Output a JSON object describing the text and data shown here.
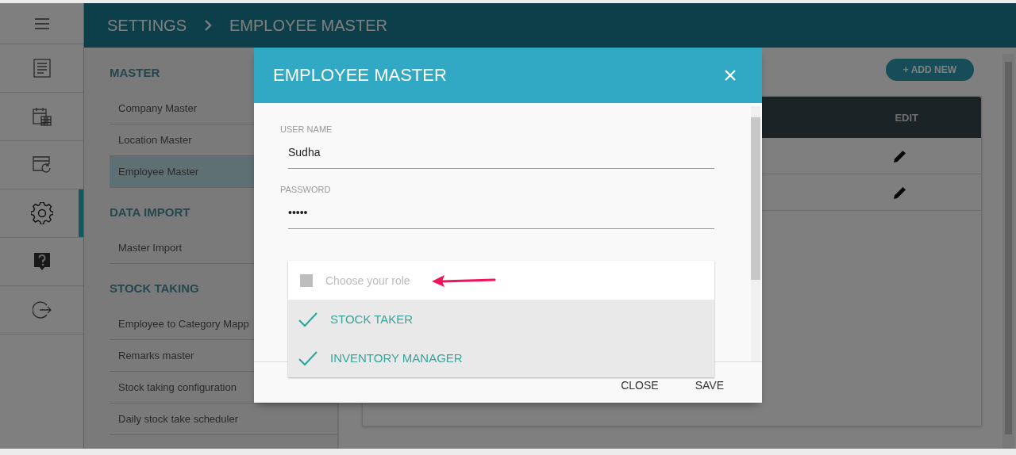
{
  "nav_rail": {
    "items": [
      {
        "kind": "report",
        "selected": false
      },
      {
        "kind": "calendar",
        "selected": false
      },
      {
        "kind": "window",
        "selected": false
      },
      {
        "kind": "settings",
        "selected": true
      },
      {
        "kind": "help",
        "selected": false
      },
      {
        "kind": "logout",
        "selected": false
      }
    ]
  },
  "breadcrumb": [
    "SETTINGS",
    "EMPLOYEE MASTER"
  ],
  "menu": {
    "sections": [
      {
        "title": "MASTER",
        "items": [
          {
            "label": "Company Master",
            "selected": false
          },
          {
            "label": "Location Master",
            "selected": false
          },
          {
            "label": "Employee Master",
            "selected": true
          }
        ]
      },
      {
        "title": "DATA IMPORT",
        "items": [
          {
            "label": "Master Import",
            "selected": false
          }
        ]
      },
      {
        "title": "STOCK TAKING",
        "items": [
          {
            "label": "Employee to Category Mapp",
            "selected": false
          },
          {
            "label": "Remarks master",
            "selected": false
          },
          {
            "label": "Stock taking configuration",
            "selected": false
          },
          {
            "label": "Daily stock take scheduler",
            "selected": false
          }
        ]
      }
    ]
  },
  "content": {
    "add_button": "+ ADD NEW",
    "table": {
      "columns": [
        "EDIT"
      ],
      "rows": [
        {
          "kind": "editable"
        },
        {
          "kind": "editable"
        }
      ]
    }
  },
  "dialog": {
    "title": "EMPLOYEE MASTER",
    "fields": [
      {
        "label": "USER NAME",
        "value": "Sudha"
      },
      {
        "label": "PASSWORD",
        "value": "•••••"
      }
    ],
    "role_select": {
      "placeholder": "Choose your role",
      "options": [
        {
          "label": "STOCK TAKER",
          "checked": true
        },
        {
          "label": "INVENTORY MANAGER",
          "checked": true
        }
      ]
    },
    "buttons": [
      "CLOSE",
      "SAVE"
    ]
  }
}
